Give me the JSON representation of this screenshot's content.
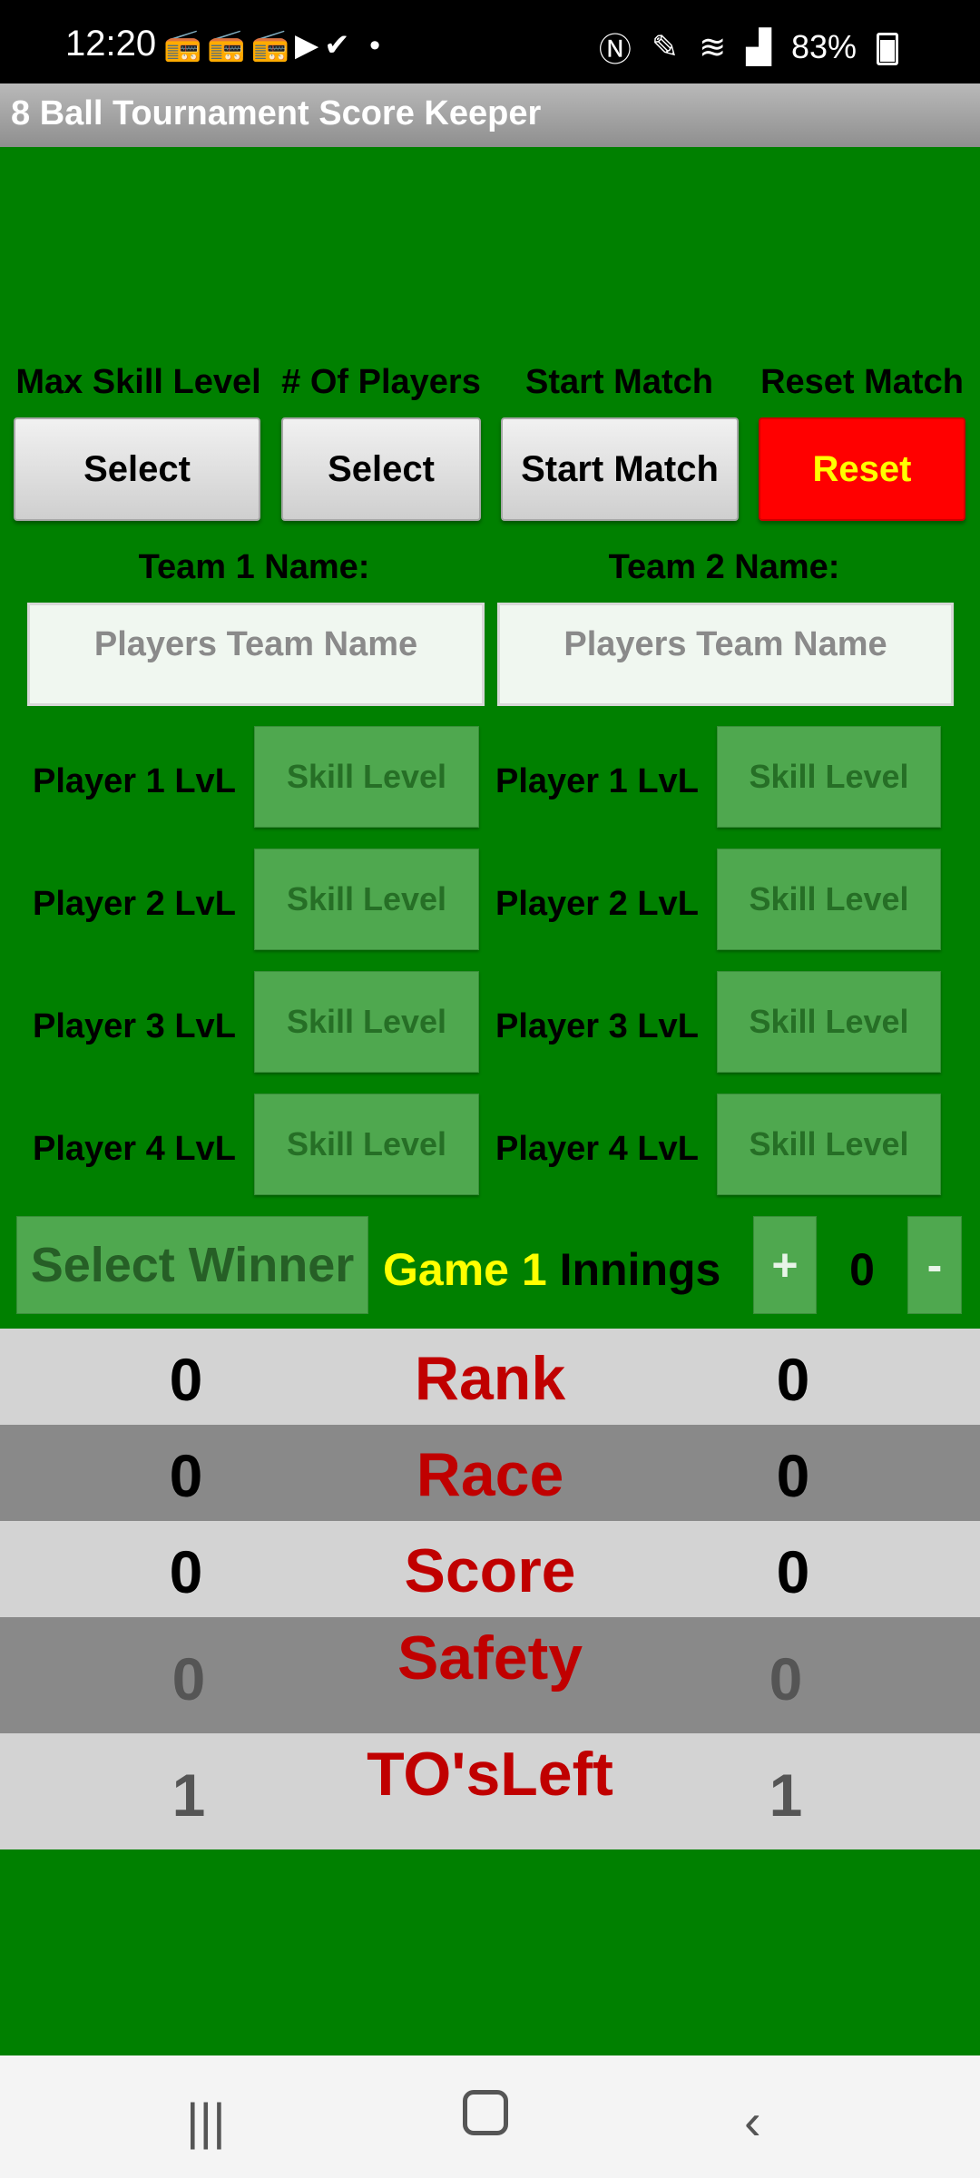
{
  "status_bar": {
    "time": "12:20",
    "left_icons": "📻📻📻▶✔ •",
    "battery": "83%"
  },
  "app_title": "8 Ball Tournament Score Keeper",
  "controls": {
    "max_skill_label": "Max Skill Level",
    "num_players_label": "# Of Players",
    "start_match_label": "Start Match",
    "reset_match_label": "Reset Match",
    "max_skill_button": "Select",
    "num_players_button": "Select",
    "start_match_button": "Start Match",
    "reset_button": "Reset"
  },
  "teams": {
    "team1_label": "Team 1 Name:",
    "team2_label": "Team 2 Name:",
    "team1_placeholder": "Players Team Name",
    "team2_placeholder": "Players Team Name"
  },
  "players": {
    "team1": [
      {
        "label": "Player 1 LvL",
        "button": "Skill Level"
      },
      {
        "label": "Player 2 LvL",
        "button": "Skill Level"
      },
      {
        "label": "Player 3 LvL",
        "button": "Skill Level"
      },
      {
        "label": "Player 4 LvL",
        "button": "Skill Level"
      }
    ],
    "team2": [
      {
        "label": "Player 1 LvL",
        "button": "Skill Level"
      },
      {
        "label": "Player 2 LvL",
        "button": "Skill Level"
      },
      {
        "label": "Player 3 LvL",
        "button": "Skill Level"
      },
      {
        "label": "Player 4 LvL",
        "button": "Skill Level"
      }
    ]
  },
  "game": {
    "select_winner": "Select Winner",
    "game_label": "Game 1",
    "innings_label": "Innings",
    "plus": "+",
    "innings_value": "0",
    "minus": "-"
  },
  "scoreboard": [
    {
      "title": "Rank",
      "left": "0",
      "right": "0"
    },
    {
      "title": "Race",
      "left": "0",
      "right": "0"
    },
    {
      "title": "Score",
      "left": "0",
      "right": "0"
    },
    {
      "title": "Safety",
      "left": "0",
      "right": "0"
    },
    {
      "title": "TO'sLeft",
      "left": "1",
      "right": "1"
    }
  ],
  "colors": {
    "background": "#008000",
    "reset_button": "#ff0000",
    "reset_text": "#ffff00",
    "game_highlight": "#ffff00",
    "score_title": "#c00000"
  }
}
